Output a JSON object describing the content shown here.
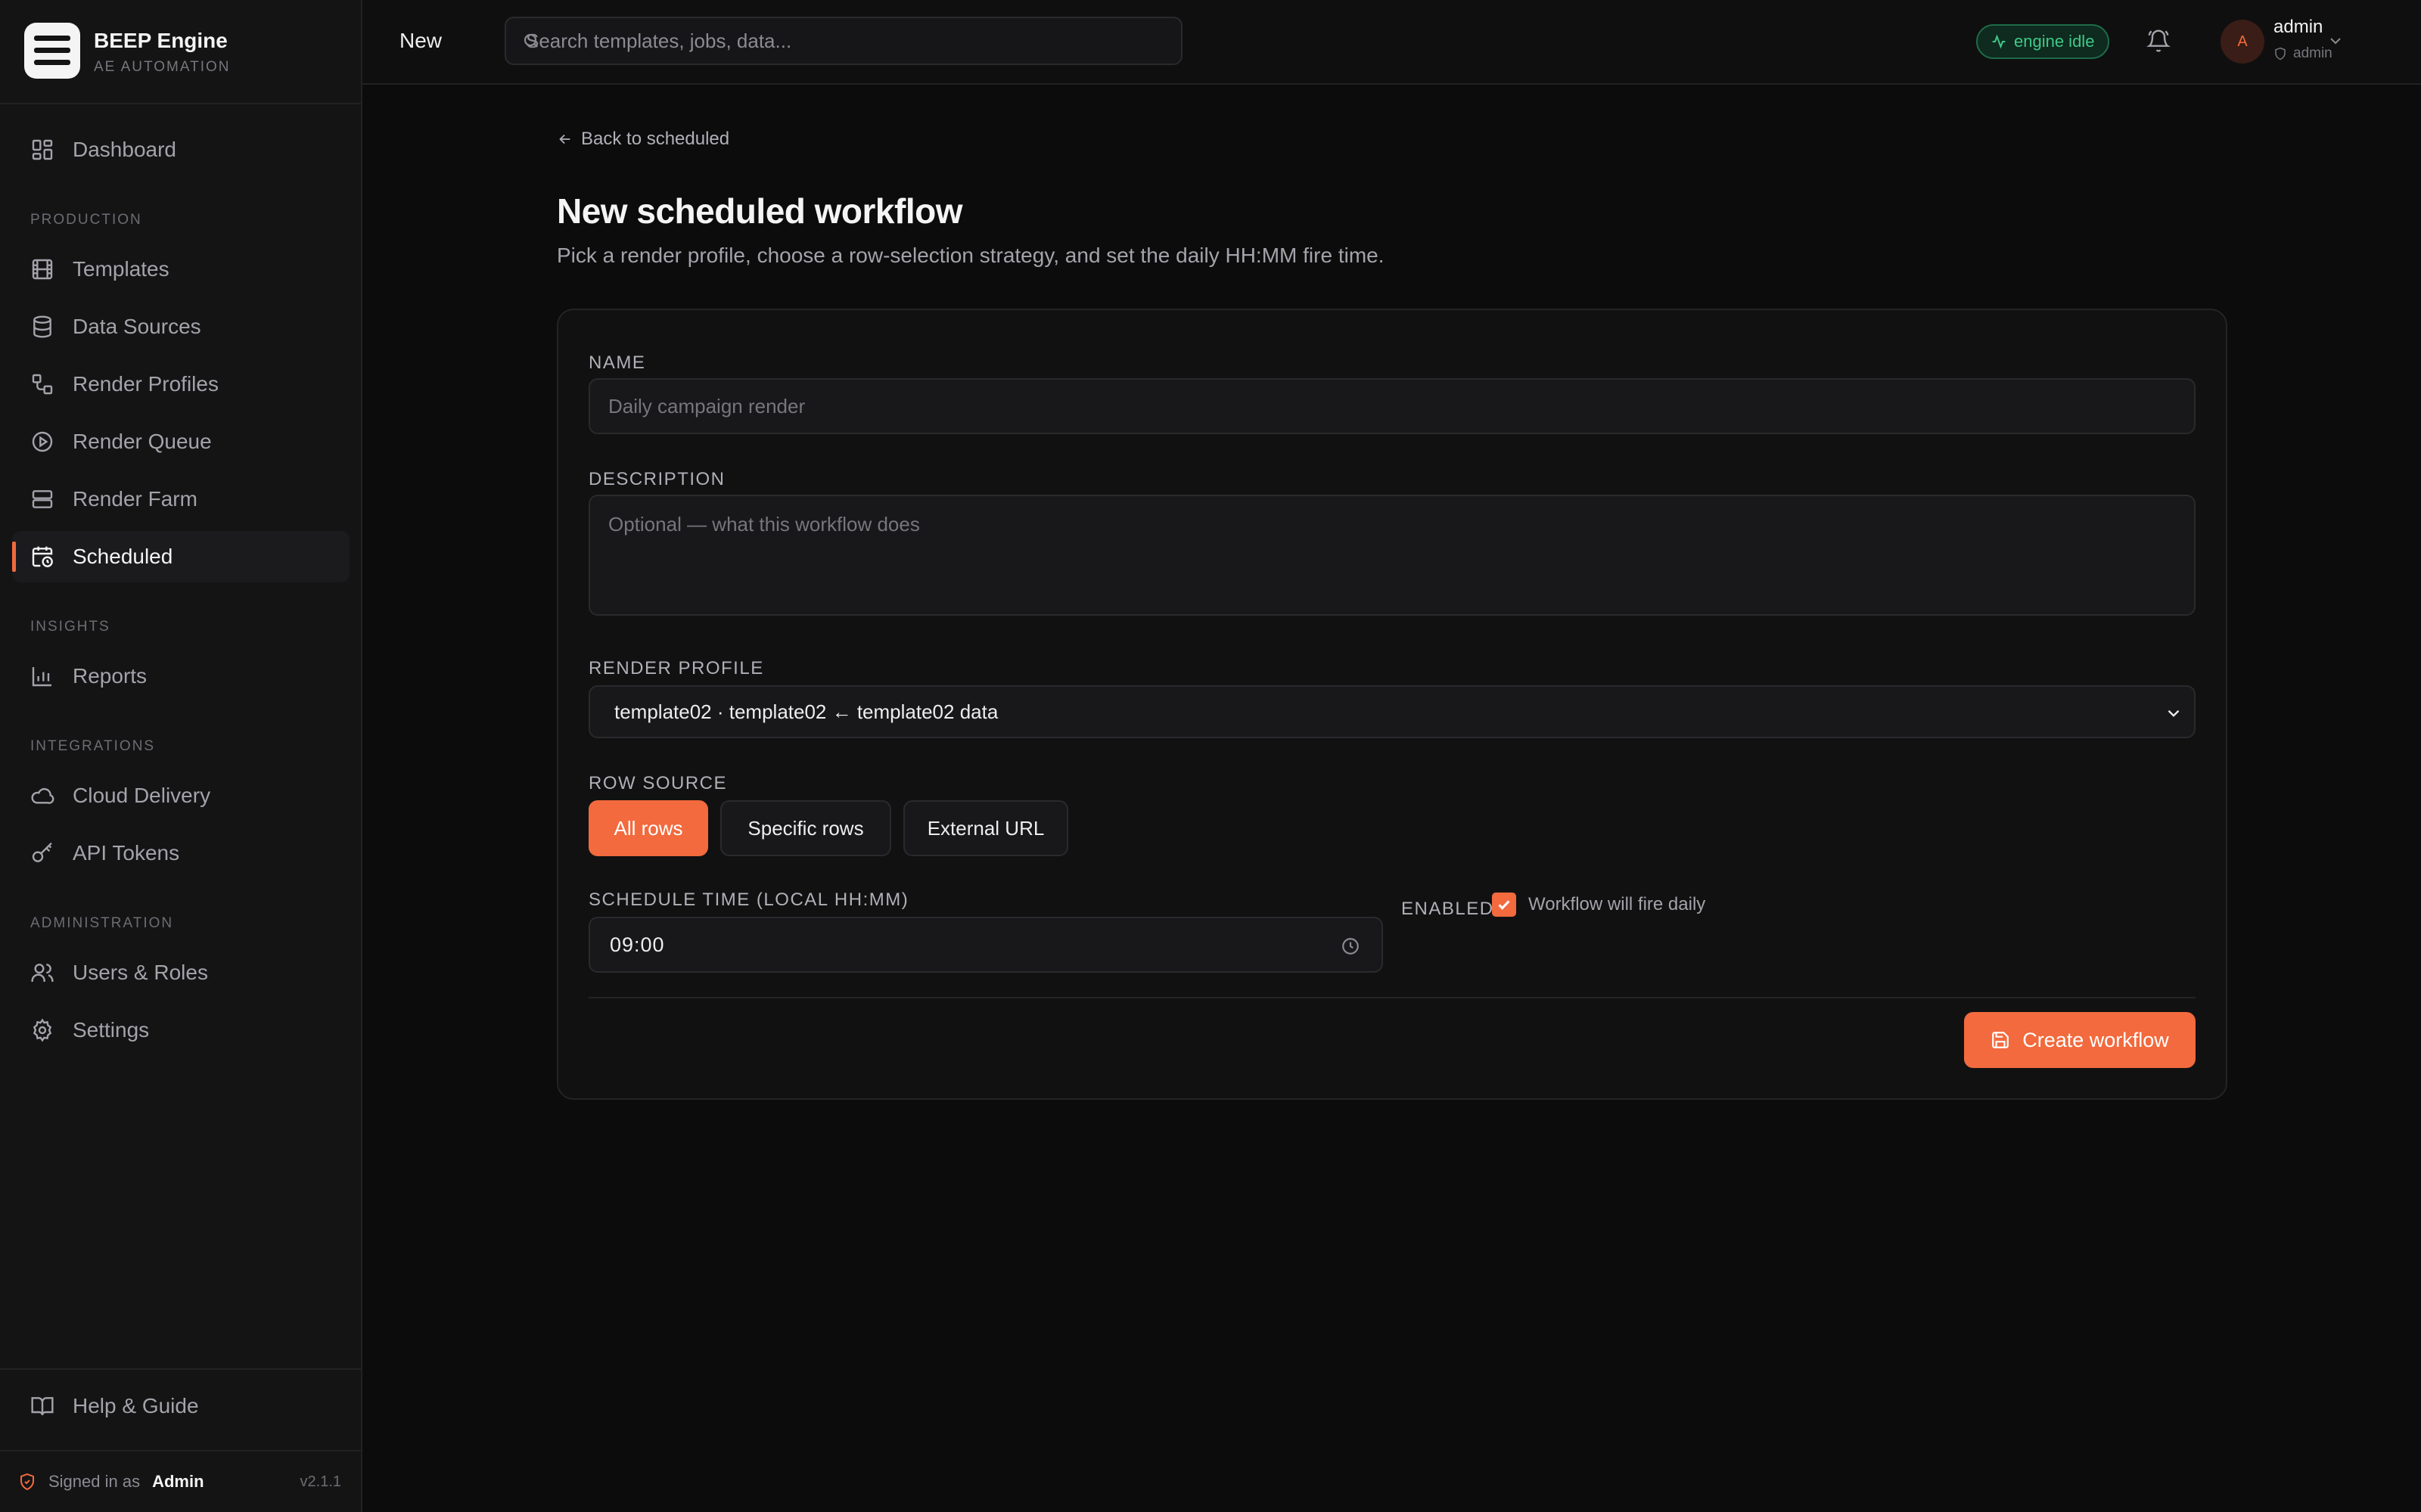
{
  "brand": {
    "name": "BEEP Engine",
    "subtitle": "AE AUTOMATION"
  },
  "sidebar": {
    "top_item": {
      "label": "Dashboard",
      "icon": "dashboard-icon"
    },
    "sections": [
      {
        "title": "PRODUCTION",
        "items": [
          {
            "label": "Templates",
            "icon": "film-icon"
          },
          {
            "label": "Data Sources",
            "icon": "database-icon"
          },
          {
            "label": "Render Profiles",
            "icon": "workflow-icon"
          },
          {
            "label": "Render Queue",
            "icon": "play-circle-icon"
          },
          {
            "label": "Render Farm",
            "icon": "server-icon"
          },
          {
            "label": "Scheduled",
            "icon": "calendar-clock-icon",
            "active": true
          }
        ]
      },
      {
        "title": "INSIGHTS",
        "items": [
          {
            "label": "Reports",
            "icon": "bar-chart-icon"
          }
        ]
      },
      {
        "title": "INTEGRATIONS",
        "items": [
          {
            "label": "Cloud Delivery",
            "icon": "cloud-icon"
          },
          {
            "label": "API Tokens",
            "icon": "key-icon"
          }
        ]
      },
      {
        "title": "ADMINISTRATION",
        "items": [
          {
            "label": "Users & Roles",
            "icon": "users-icon"
          },
          {
            "label": "Settings",
            "icon": "gear-icon"
          }
        ]
      }
    ],
    "help": {
      "label": "Help & Guide",
      "icon": "book-icon"
    },
    "signed_in": {
      "prefix": "Signed in as",
      "user": "Admin",
      "version": "v2.1.1"
    }
  },
  "topbar": {
    "breadcrumb": "New",
    "search_placeholder": "Search templates, jobs, data...",
    "engine_status": "engine idle",
    "user": {
      "name": "admin",
      "role": "admin",
      "avatar_letter": "A"
    }
  },
  "page": {
    "back_label": "Back to scheduled",
    "title": "New scheduled workflow",
    "subtitle": "Pick a render profile, choose a row-selection strategy, and set the daily HH:MM fire time."
  },
  "form": {
    "name_label": "NAME",
    "name_placeholder": "Daily campaign render",
    "name_value": "",
    "description_label": "DESCRIPTION",
    "description_placeholder": "Optional — what this workflow does",
    "profile_label": "RENDER PROFILE",
    "profile_value": "template02 · template02 ← template02 data",
    "row_source_label": "ROW SOURCE",
    "row_source_options": [
      "All rows",
      "Specific rows",
      "External URL"
    ],
    "row_source_selected": "All rows",
    "schedule_label": "SCHEDULE TIME (LOCAL HH:MM)",
    "schedule_value": "09:00",
    "enabled_label": "ENABLED",
    "enabled_checked": true,
    "enabled_hint": "Workflow will fire daily",
    "submit_label": "Create workflow"
  },
  "colors": {
    "accent": "#f26a3d",
    "background": "#0c0c0d",
    "success": "#3ec98a"
  }
}
